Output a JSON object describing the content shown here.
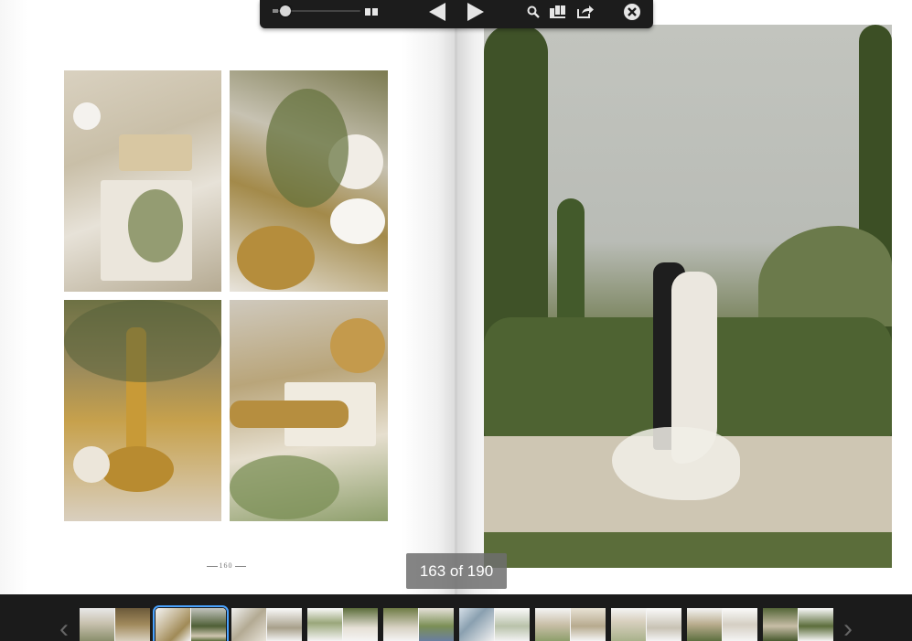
{
  "viewer": {
    "page_indicator": "163 of 190",
    "left_page_number": "160",
    "current_page": 163,
    "total_pages": 190
  },
  "toolbar": {
    "zoom_slider": {
      "value": 0.1
    },
    "icons": [
      "zoom-slider",
      "two-page-view-icon",
      "previous-page-icon",
      "next-page-icon",
      "search-icon",
      "thumbnails-icon",
      "share-icon",
      "close-icon"
    ]
  },
  "thumbnails": {
    "count": 10,
    "active_index": 1
  },
  "colors": {
    "toolbar_bg": "#1c1c1c",
    "strip_bg": "#1b1b1b",
    "active_thumb_border": "#4aa3ff",
    "indicator_bg": "#6e6e6e"
  }
}
